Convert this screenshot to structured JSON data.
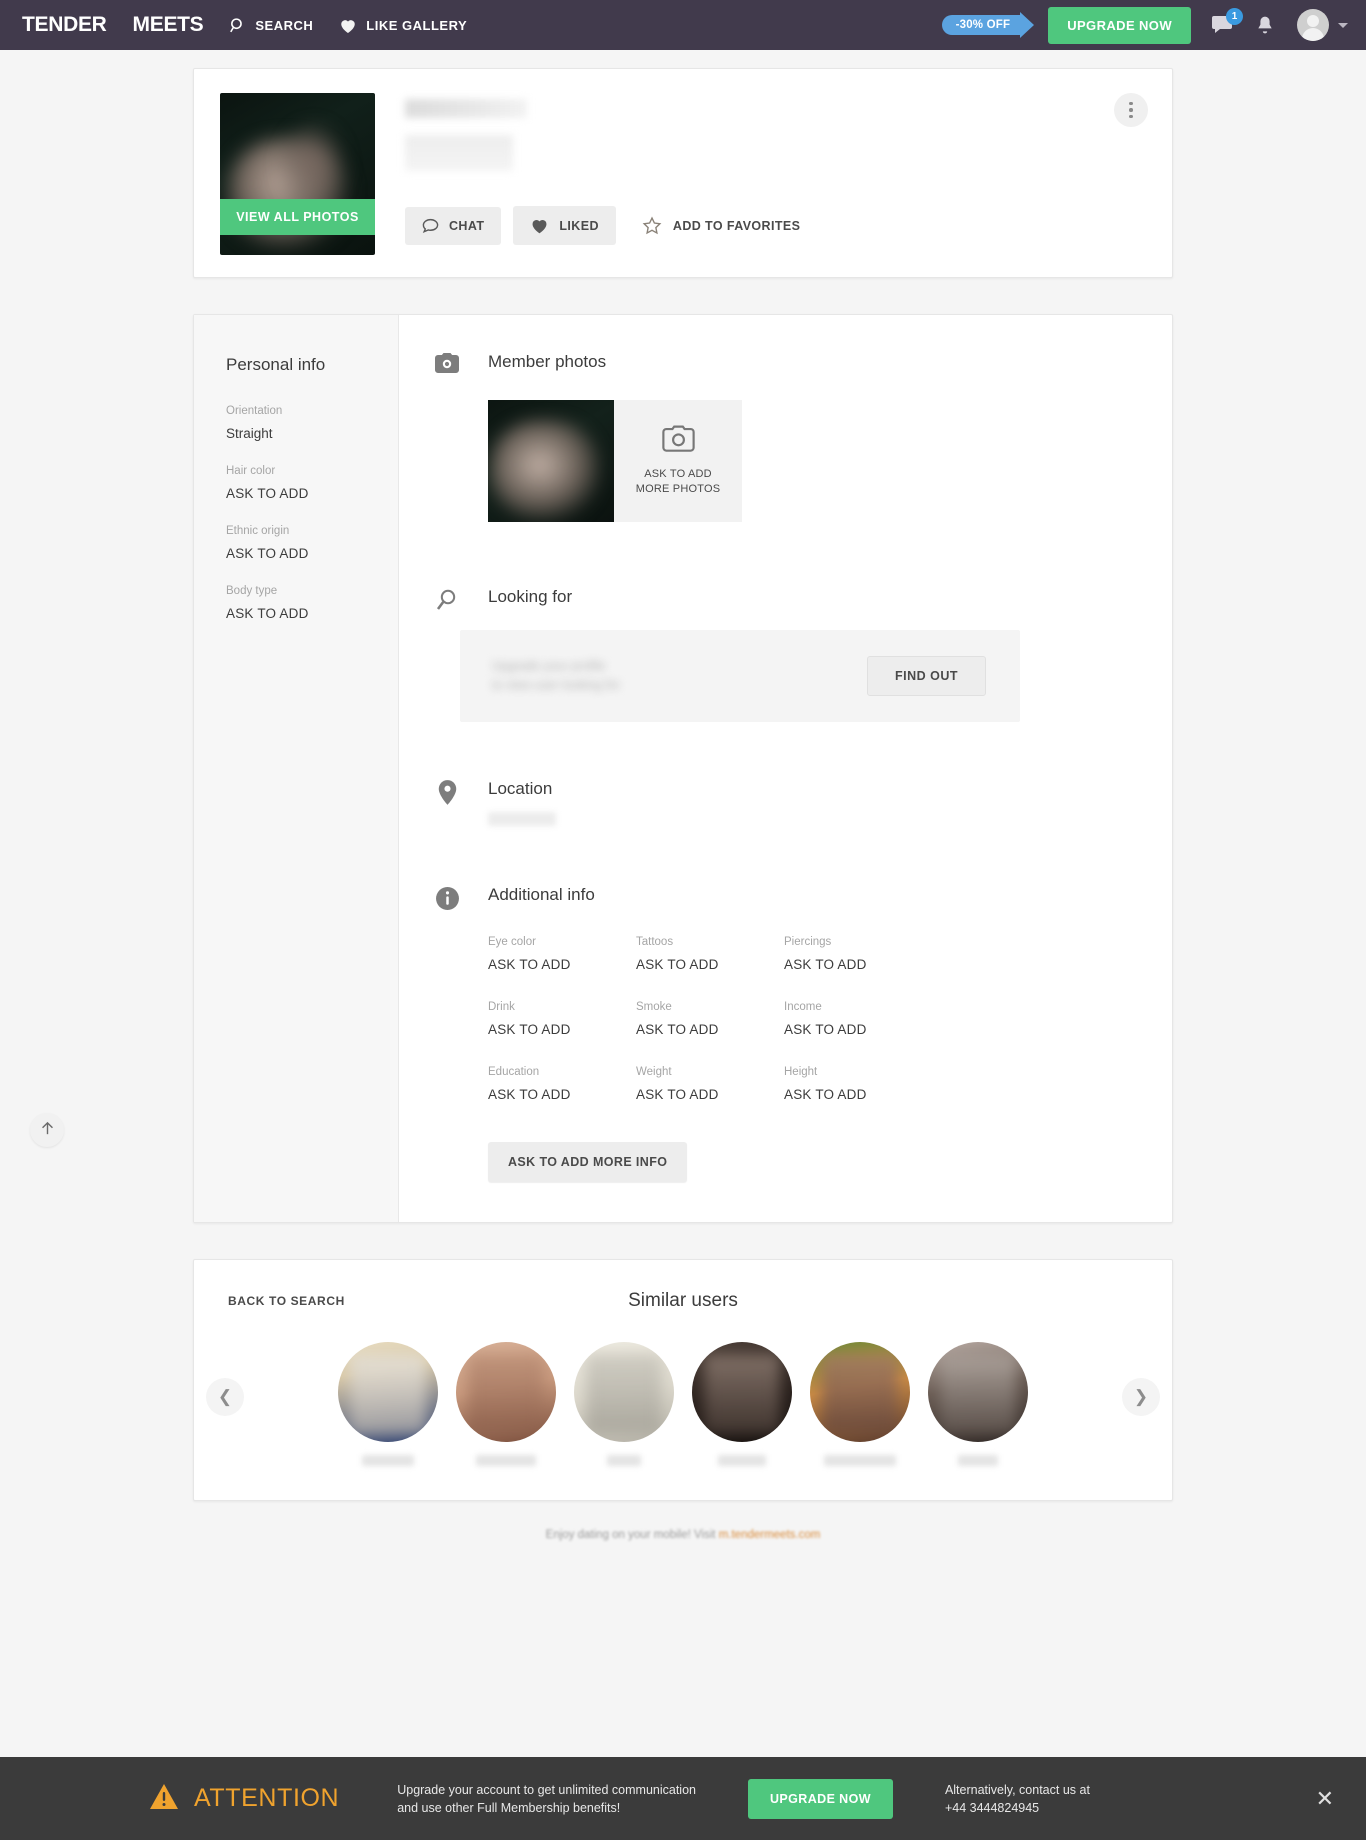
{
  "header": {
    "logo": {
      "part1": "TENDER",
      "part2": "MEETS"
    },
    "nav": [
      {
        "id": "search",
        "label": "SEARCH",
        "icon": "search-icon"
      },
      {
        "id": "like-gallery",
        "label": "LIKE GALLERY",
        "icon": "heart-icon"
      }
    ],
    "discount_badge": "-30% OFF",
    "upgrade_label": "UPGRADE NOW",
    "messages_badge": "1",
    "icons": {
      "messages": "chat-bubble-icon",
      "notifications": "bell-icon",
      "avatar": "user-avatar",
      "caret": "chevron-down-icon"
    }
  },
  "profile": {
    "view_all_photos": "VIEW ALL PHOTOS",
    "actions": [
      {
        "id": "chat",
        "label": "CHAT",
        "icon": "chat-bubble-icon",
        "style": "filled"
      },
      {
        "id": "liked",
        "label": "LIKED",
        "icon": "heart-icon",
        "style": "filled"
      },
      {
        "id": "favorites",
        "label": "ADD TO FAVORITES",
        "icon": "star-icon",
        "style": "plain"
      }
    ],
    "more_menu_icon": "kebab-menu-icon"
  },
  "sidebar": {
    "title": "Personal info",
    "fields": [
      {
        "label": "Orientation",
        "value": "Straight"
      },
      {
        "label": "Hair color",
        "value": "ASK TO ADD"
      },
      {
        "label": "Ethnic origin",
        "value": "ASK TO ADD"
      },
      {
        "label": "Body type",
        "value": "ASK TO ADD"
      }
    ]
  },
  "sections": {
    "member_photos": {
      "title": "Member photos",
      "icon": "camera-icon",
      "add_more_label": "ASK TO ADD MORE PHOTOS",
      "add_more_icon": "camera-outline-icon"
    },
    "looking_for": {
      "title": "Looking for",
      "icon": "magnifier-icon",
      "blurred_text_line1": "Upgrade your profile",
      "blurred_text_line2": "to view user looking for",
      "find_out_label": "FIND OUT"
    },
    "location": {
      "title": "Location",
      "icon": "map-pin-icon"
    },
    "additional_info": {
      "title": "Additional info",
      "icon": "info-icon",
      "fields": [
        {
          "label": "Eye color",
          "value": "ASK TO ADD"
        },
        {
          "label": "Tattoos",
          "value": "ASK TO ADD"
        },
        {
          "label": "Piercings",
          "value": "ASK TO ADD"
        },
        {
          "label": "Drink",
          "value": "ASK TO ADD"
        },
        {
          "label": "Smoke",
          "value": "ASK TO ADD"
        },
        {
          "label": "Income",
          "value": "ASK TO ADD"
        },
        {
          "label": "Education",
          "value": "ASK TO ADD"
        },
        {
          "label": "Weight",
          "value": "ASK TO ADD"
        },
        {
          "label": "Height",
          "value": "ASK TO ADD"
        }
      ],
      "add_more_label": "ASK TO ADD MORE INFO"
    }
  },
  "similar_users": {
    "back_label": "BACK TO SEARCH",
    "title": "Similar users",
    "prev_icon": "chevron-left-icon",
    "next_icon": "chevron-right-icon",
    "items": [
      {
        "id": 1,
        "name_width": 52,
        "c1": "#e8dcc0",
        "c2": "#2b3f72"
      },
      {
        "id": 2,
        "name_width": 60,
        "c1": "#c99a7e",
        "c2": "#8a5a46"
      },
      {
        "id": 3,
        "name_width": 34,
        "c1": "#e6e3d8",
        "c2": "#a3a096"
      },
      {
        "id": 4,
        "name_width": 48,
        "c1": "#6a5a50",
        "c2": "#1d1916"
      },
      {
        "id": 5,
        "name_width": 72,
        "c1": "#7c8a3c",
        "c2": "#5a3a2c"
      },
      {
        "id": 6,
        "name_width": 40,
        "c1": "#9a8a84",
        "c2": "#3b3230"
      }
    ]
  },
  "footer_note": {
    "text": "Enjoy dating on your mobile! Visit",
    "link": "m.tendermeets.com"
  },
  "scroll_top_icon": "arrow-up-icon",
  "banner": {
    "warning_icon": "warning-triangle-icon",
    "attention": "ATTENTION",
    "message_line1": "Upgrade your account to get unlimited communication",
    "message_line2": "and use other Full Membership benefits!",
    "upgrade_label": "UPGRADE NOW",
    "contact_line1": "Alternatively, contact us at",
    "contact_line2": "+44 3444824945",
    "close_icon": "close-icon"
  },
  "colors": {
    "header_bg": "#413a4c",
    "accent_green": "#4fc77e",
    "accent_blue": "#5ba3e0",
    "banner_bg": "#3b3b3b",
    "attention_orange": "#f0a32e",
    "logo_pink": "#e0419b",
    "logo_blue": "#5c8fd6"
  }
}
